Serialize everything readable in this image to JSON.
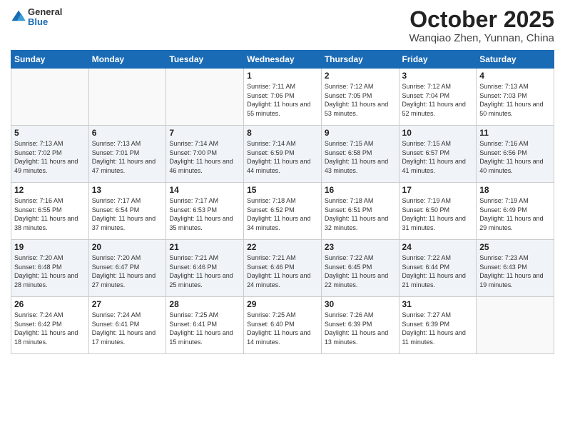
{
  "logo": {
    "general": "General",
    "blue": "Blue"
  },
  "header": {
    "month": "October 2025",
    "location": "Wanqiao Zhen, Yunnan, China"
  },
  "weekdays": [
    "Sunday",
    "Monday",
    "Tuesday",
    "Wednesday",
    "Thursday",
    "Friday",
    "Saturday"
  ],
  "weeks": [
    [
      {
        "day": "",
        "info": ""
      },
      {
        "day": "",
        "info": ""
      },
      {
        "day": "",
        "info": ""
      },
      {
        "day": "1",
        "info": "Sunrise: 7:11 AM\nSunset: 7:06 PM\nDaylight: 11 hours and 55 minutes."
      },
      {
        "day": "2",
        "info": "Sunrise: 7:12 AM\nSunset: 7:05 PM\nDaylight: 11 hours and 53 minutes."
      },
      {
        "day": "3",
        "info": "Sunrise: 7:12 AM\nSunset: 7:04 PM\nDaylight: 11 hours and 52 minutes."
      },
      {
        "day": "4",
        "info": "Sunrise: 7:13 AM\nSunset: 7:03 PM\nDaylight: 11 hours and 50 minutes."
      }
    ],
    [
      {
        "day": "5",
        "info": "Sunrise: 7:13 AM\nSunset: 7:02 PM\nDaylight: 11 hours and 49 minutes."
      },
      {
        "day": "6",
        "info": "Sunrise: 7:13 AM\nSunset: 7:01 PM\nDaylight: 11 hours and 47 minutes."
      },
      {
        "day": "7",
        "info": "Sunrise: 7:14 AM\nSunset: 7:00 PM\nDaylight: 11 hours and 46 minutes."
      },
      {
        "day": "8",
        "info": "Sunrise: 7:14 AM\nSunset: 6:59 PM\nDaylight: 11 hours and 44 minutes."
      },
      {
        "day": "9",
        "info": "Sunrise: 7:15 AM\nSunset: 6:58 PM\nDaylight: 11 hours and 43 minutes."
      },
      {
        "day": "10",
        "info": "Sunrise: 7:15 AM\nSunset: 6:57 PM\nDaylight: 11 hours and 41 minutes."
      },
      {
        "day": "11",
        "info": "Sunrise: 7:16 AM\nSunset: 6:56 PM\nDaylight: 11 hours and 40 minutes."
      }
    ],
    [
      {
        "day": "12",
        "info": "Sunrise: 7:16 AM\nSunset: 6:55 PM\nDaylight: 11 hours and 38 minutes."
      },
      {
        "day": "13",
        "info": "Sunrise: 7:17 AM\nSunset: 6:54 PM\nDaylight: 11 hours and 37 minutes."
      },
      {
        "day": "14",
        "info": "Sunrise: 7:17 AM\nSunset: 6:53 PM\nDaylight: 11 hours and 35 minutes."
      },
      {
        "day": "15",
        "info": "Sunrise: 7:18 AM\nSunset: 6:52 PM\nDaylight: 11 hours and 34 minutes."
      },
      {
        "day": "16",
        "info": "Sunrise: 7:18 AM\nSunset: 6:51 PM\nDaylight: 11 hours and 32 minutes."
      },
      {
        "day": "17",
        "info": "Sunrise: 7:19 AM\nSunset: 6:50 PM\nDaylight: 11 hours and 31 minutes."
      },
      {
        "day": "18",
        "info": "Sunrise: 7:19 AM\nSunset: 6:49 PM\nDaylight: 11 hours and 29 minutes."
      }
    ],
    [
      {
        "day": "19",
        "info": "Sunrise: 7:20 AM\nSunset: 6:48 PM\nDaylight: 11 hours and 28 minutes."
      },
      {
        "day": "20",
        "info": "Sunrise: 7:20 AM\nSunset: 6:47 PM\nDaylight: 11 hours and 27 minutes."
      },
      {
        "day": "21",
        "info": "Sunrise: 7:21 AM\nSunset: 6:46 PM\nDaylight: 11 hours and 25 minutes."
      },
      {
        "day": "22",
        "info": "Sunrise: 7:21 AM\nSunset: 6:46 PM\nDaylight: 11 hours and 24 minutes."
      },
      {
        "day": "23",
        "info": "Sunrise: 7:22 AM\nSunset: 6:45 PM\nDaylight: 11 hours and 22 minutes."
      },
      {
        "day": "24",
        "info": "Sunrise: 7:22 AM\nSunset: 6:44 PM\nDaylight: 11 hours and 21 minutes."
      },
      {
        "day": "25",
        "info": "Sunrise: 7:23 AM\nSunset: 6:43 PM\nDaylight: 11 hours and 19 minutes."
      }
    ],
    [
      {
        "day": "26",
        "info": "Sunrise: 7:24 AM\nSunset: 6:42 PM\nDaylight: 11 hours and 18 minutes."
      },
      {
        "day": "27",
        "info": "Sunrise: 7:24 AM\nSunset: 6:41 PM\nDaylight: 11 hours and 17 minutes."
      },
      {
        "day": "28",
        "info": "Sunrise: 7:25 AM\nSunset: 6:41 PM\nDaylight: 11 hours and 15 minutes."
      },
      {
        "day": "29",
        "info": "Sunrise: 7:25 AM\nSunset: 6:40 PM\nDaylight: 11 hours and 14 minutes."
      },
      {
        "day": "30",
        "info": "Sunrise: 7:26 AM\nSunset: 6:39 PM\nDaylight: 11 hours and 13 minutes."
      },
      {
        "day": "31",
        "info": "Sunrise: 7:27 AM\nSunset: 6:39 PM\nDaylight: 11 hours and 11 minutes."
      },
      {
        "day": "",
        "info": ""
      }
    ]
  ]
}
